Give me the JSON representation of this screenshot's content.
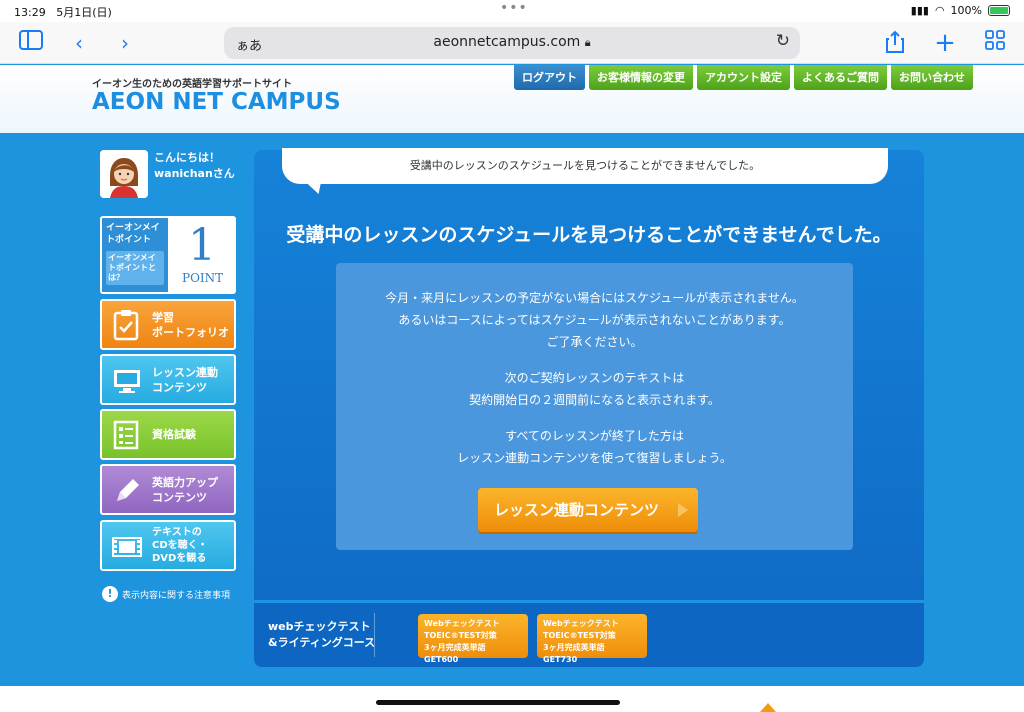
{
  "status": {
    "time": "13:29",
    "date": "5月1日(日)",
    "battery": "100%"
  },
  "browser": {
    "aa": "ぁあ",
    "url": "aeonnetcampus.com"
  },
  "header": {
    "tagline": "イーオン生のための英語学習サポートサイト",
    "logo": "AEON NET CAMPUS",
    "nav": [
      {
        "label": "ログアウト"
      },
      {
        "label": "お客様情報の変更"
      },
      {
        "label": "アカウント設定"
      },
      {
        "label": "よくあるご質問"
      },
      {
        "label": "お問い合わせ"
      }
    ]
  },
  "user": {
    "greeting": "こんにちは！",
    "name": "wanichanさん"
  },
  "points": {
    "title": "イーオンメイトポイント",
    "link": "イーオンメイトポイントとは？",
    "value": "1",
    "unit": "POINT"
  },
  "sidebar": [
    {
      "label1": "学習",
      "label2": "ポートフォリオ"
    },
    {
      "label1": "レッスン連動",
      "label2": "コンテンツ"
    },
    {
      "label1": "資格試験",
      "label2": ""
    },
    {
      "label1": "英語力アップ",
      "label2": "コンテンツ"
    },
    {
      "label1": "テキストの",
      "label2": "CDを聴く・",
      "label3": "DVDを観る"
    }
  ],
  "notice": "表示内容に関する注意事項",
  "main": {
    "bubble": "受講中のレッスンのスケジュールを見つけることができませんでした。",
    "title": "受講中のレッスンのスケジュールを見つけることができませんでした。",
    "p1": [
      "今月・来月にレッスンの予定がない場合にはスケジュールが表示されません。",
      "あるいはコースによってはスケジュールが表示されないことがあります。",
      "ご了承ください。"
    ],
    "p2": [
      "次のご契約レッスンのテキストは",
      "契約開始日の２週間前になると表示されます。"
    ],
    "p3": [
      "すべてのレッスンが終了した方は",
      "レッスン連動コンテンツを使って復習しましょう。"
    ],
    "cta": "レッスン連動コンテンツ"
  },
  "bottom": {
    "left1": "webチェックテスト",
    "left2": "&ライティングコース",
    "buttons": [
      {
        "l1": "Webチェックテスト",
        "l2": "TOEIC®TEST対策",
        "l3": "3ヶ月完成英単語 GET600"
      },
      {
        "l1": "Webチェックテスト",
        "l2": "TOEIC®TEST対策",
        "l3": "3ヶ月完成英単語 GET730"
      }
    ]
  }
}
